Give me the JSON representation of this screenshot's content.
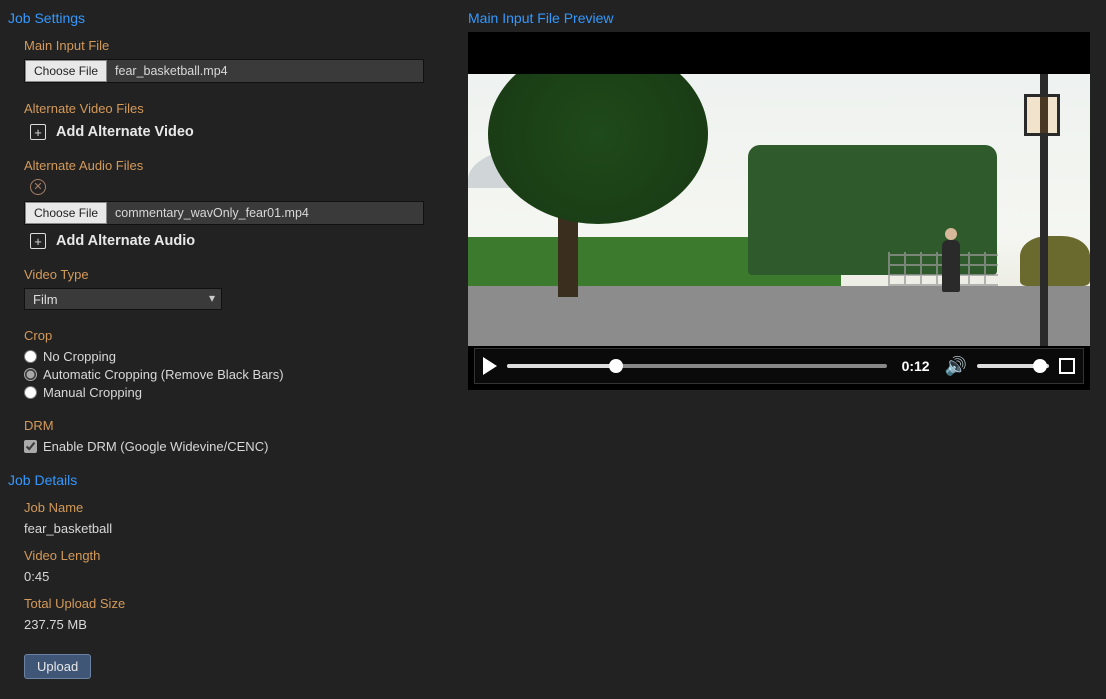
{
  "section_titles": {
    "job_settings": "Job Settings",
    "preview": "Main Input File Preview",
    "job_details": "Job Details"
  },
  "labels": {
    "main_input": "Main Input File",
    "alt_video": "Alternate Video Files",
    "alt_audio": "Alternate Audio Files",
    "video_type": "Video Type",
    "crop": "Crop",
    "drm": "DRM",
    "job_name": "Job Name",
    "video_length": "Video Length",
    "total_upload": "Total Upload Size"
  },
  "buttons": {
    "choose_file": "Choose File",
    "add_alt_video": "Add Alternate Video",
    "add_alt_audio": "Add Alternate Audio",
    "upload": "Upload"
  },
  "files": {
    "main_input": "fear_basketball.mp4",
    "alt_audio_1": "commentary_wavOnly_fear01.mp4"
  },
  "video_type_selected": "Film",
  "crop_options": {
    "none": "No Cropping",
    "auto": "Automatic Cropping (Remove Black Bars)",
    "manual": "Manual Cropping"
  },
  "crop_selected": "auto",
  "drm_label": "Enable DRM (Google Widevine/CENC)",
  "drm_checked": true,
  "details": {
    "job_name": "fear_basketball",
    "video_length": "0:45",
    "total_upload": "237.75 MB"
  },
  "player": {
    "current_time": "0:12"
  }
}
